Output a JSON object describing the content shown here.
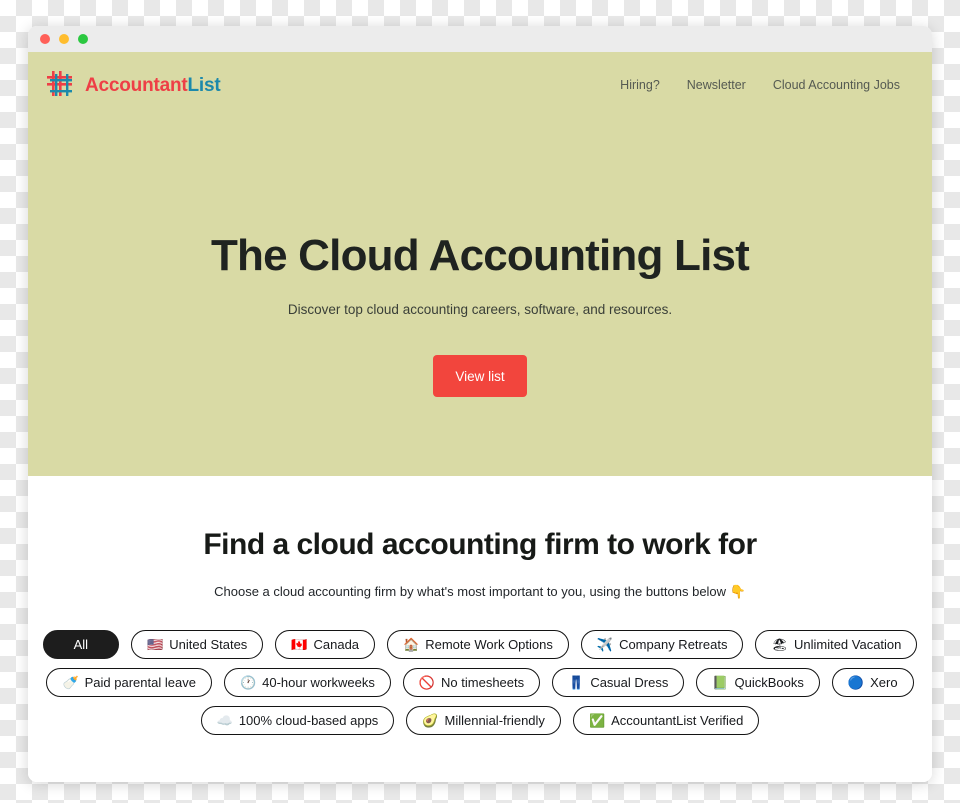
{
  "window": {
    "traffic_lights": [
      "close",
      "minimize",
      "maximize"
    ]
  },
  "hero": {
    "brand": {
      "logo_icon": "grid-hash-logo-icon",
      "name_part1": "Accountant",
      "name_part2": "List",
      "color_part1": "#ee3f46",
      "color_part2": "#1c89ab"
    },
    "nav": [
      {
        "label": "Hiring?"
      },
      {
        "label": "Newsletter"
      },
      {
        "label": "Cloud Accounting Jobs"
      }
    ],
    "title": "The Cloud Accounting List",
    "subtitle": "Discover top cloud accounting careers, software, and resources.",
    "cta_label": "View list",
    "cta_color": "#f2453d",
    "background_color": "#d9daa5"
  },
  "find": {
    "title": "Find a cloud accounting firm to work for",
    "subtitle": "Choose a cloud accounting firm by what's most important to you, using the buttons below 👇",
    "filter_rows": [
      [
        {
          "emoji": "",
          "label": "All",
          "active": true,
          "icon_name": "none"
        },
        {
          "emoji": "🇺🇸",
          "label": "United States",
          "active": false,
          "icon_name": "flag-us-icon"
        },
        {
          "emoji": "🇨🇦",
          "label": "Canada",
          "active": false,
          "icon_name": "flag-canada-icon"
        },
        {
          "emoji": "🏠",
          "label": "Remote Work Options",
          "active": false,
          "icon_name": "house-icon"
        },
        {
          "emoji": "✈️",
          "label": "Company Retreats",
          "active": false,
          "icon_name": "airplane-icon"
        },
        {
          "emoji": "🏖",
          "label": "Unlimited Vacation",
          "active": false,
          "icon_name": "beach-umbrella-icon"
        }
      ],
      [
        {
          "emoji": "🍼",
          "label": "Paid parental leave",
          "active": false,
          "icon_name": "baby-bottle-icon"
        },
        {
          "emoji": "🕐",
          "label": "40-hour workweeks",
          "active": false,
          "icon_name": "clock-icon"
        },
        {
          "emoji": "🚫",
          "label": "No timesheets",
          "active": false,
          "icon_name": "prohibited-icon"
        },
        {
          "emoji": "👖",
          "label": "Casual Dress",
          "active": false,
          "icon_name": "jeans-icon"
        },
        {
          "emoji": "📗",
          "label": "QuickBooks",
          "active": false,
          "icon_name": "green-book-icon"
        },
        {
          "emoji": "🔵",
          "label": "Xero",
          "active": false,
          "icon_name": "blue-circle-icon"
        }
      ],
      [
        {
          "emoji": "☁️",
          "label": "100% cloud-based apps",
          "active": false,
          "icon_name": "cloud-icon"
        },
        {
          "emoji": "🥑",
          "label": "Millennial-friendly",
          "active": false,
          "icon_name": "avocado-icon"
        },
        {
          "emoji": "✅",
          "label": "AccountantList Verified",
          "active": false,
          "icon_name": "check-mark-icon"
        }
      ]
    ]
  }
}
